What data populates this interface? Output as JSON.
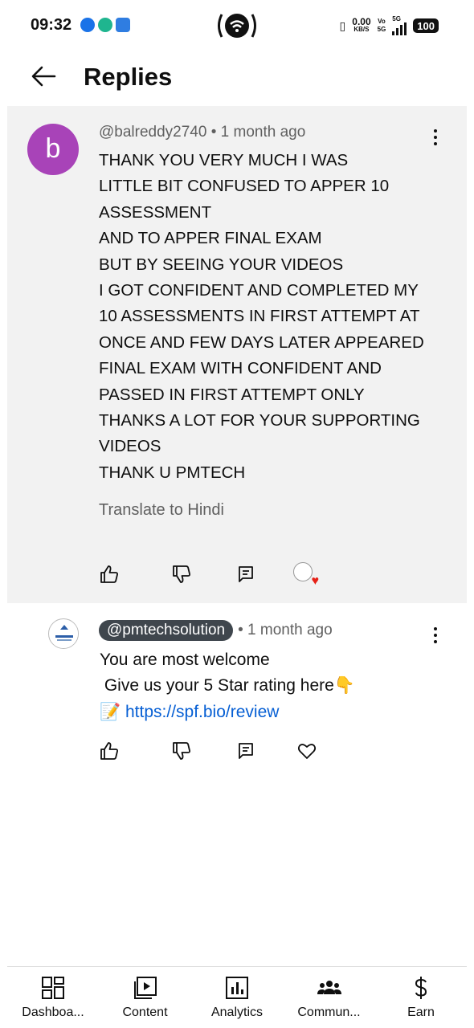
{
  "status_bar": {
    "time": "09:32",
    "net_speed_value": "0.00",
    "net_speed_unit": "KB/S",
    "volte_top": "Vo",
    "volte_bottom": "5G",
    "network_type": "5G",
    "battery": "100",
    "icons": [
      "cloud-icon",
      "vpn-icon",
      "android-icon",
      "hotspot-icon",
      "vibrate-icon",
      "signal-icon",
      "battery-icon"
    ]
  },
  "header": {
    "title": "Replies",
    "back_icon": "back-arrow-icon"
  },
  "parent_comment": {
    "avatar_letter": "b",
    "avatar_color": "#a843b8",
    "author": "@balreddy2740",
    "separator": "•",
    "time": "1 month ago",
    "lines": [
      "THANK YOU VERY MUCH I WAS",
      "LITTLE BIT CONFUSED TO APPER 10",
      "ASSESSMENT",
      "AND TO APPER FINAL EXAM",
      "BUT BY SEEING YOUR VIDEOS",
      "I GOT CONFIDENT AND COMPLETED MY",
      "10 ASSESSMENTS IN FIRST ATTEMPT AT",
      "ONCE AND FEW DAYS LATER APPEARED",
      "FINAL EXAM WITH CONFIDENT AND",
      "PASSED IN FIRST ATTEMPT ONLY",
      "THANKS A LOT FOR YOUR SUPPORTING",
      "VIDEOS",
      "THANK U PMTECH"
    ],
    "translate_label": "Translate to Hindi",
    "actions": [
      "like-icon",
      "dislike-icon",
      "reply-icon",
      "creator-heart-icon"
    ]
  },
  "reply": {
    "author": "@pmtechsolution",
    "separator": "•",
    "time": "1 month ago",
    "line1": "You are most welcome",
    "line2": " Give us your 5 Star rating here",
    "line2_emoji": "👇",
    "line3_emoji": "📝",
    "link": "https://spf.bio/review",
    "actions": [
      "like-icon",
      "dislike-icon",
      "reply-icon",
      "heart-icon"
    ]
  },
  "bottom_nav": {
    "items": [
      {
        "label": "Dashboa...",
        "icon": "dashboard-icon"
      },
      {
        "label": "Content",
        "icon": "content-icon"
      },
      {
        "label": "Analytics",
        "icon": "analytics-icon"
      },
      {
        "label": "Commun...",
        "icon": "community-icon"
      },
      {
        "label": "Earn",
        "icon": "earn-icon"
      }
    ]
  },
  "colors": {
    "accent_link": "#065fd4",
    "author_chip": "#3f464d",
    "heart": "#e62117",
    "comment_bg": "#f2f2f2"
  }
}
